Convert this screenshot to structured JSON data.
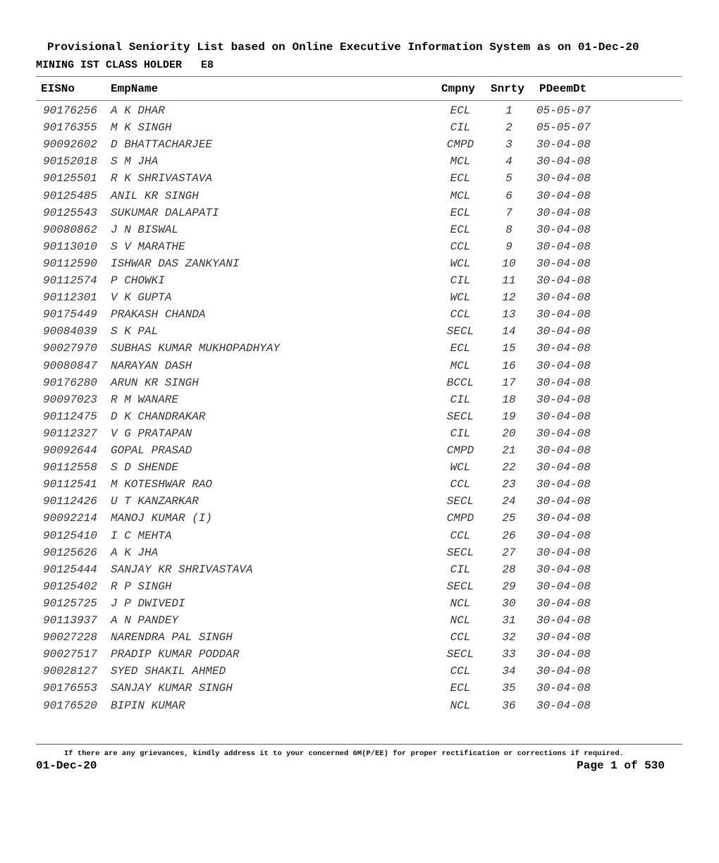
{
  "header": {
    "title": "Provisional Seniority List based on Online Executive Information System as on 01-Dec-20",
    "subtitle": "MINING IST CLASS HOLDER   E8"
  },
  "table": {
    "columns": [
      "EISNo",
      "EmpName",
      "Cmpny",
      "Snrty",
      "PDeemDt"
    ],
    "rows": [
      {
        "eis": "90176256",
        "name": "A K DHAR",
        "cmpny": "ECL",
        "snrty": "1",
        "pdeem": "05-05-07"
      },
      {
        "eis": "90176355",
        "name": "M K SINGH",
        "cmpny": "CIL",
        "snrty": "2",
        "pdeem": "05-05-07"
      },
      {
        "eis": "90092602",
        "name": "D BHATTACHARJEE",
        "cmpny": "CMPD",
        "snrty": "3",
        "pdeem": "30-04-08"
      },
      {
        "eis": "90152018",
        "name": "S M JHA",
        "cmpny": "MCL",
        "snrty": "4",
        "pdeem": "30-04-08"
      },
      {
        "eis": "90125501",
        "name": "R K SHRIVASTAVA",
        "cmpny": "ECL",
        "snrty": "5",
        "pdeem": "30-04-08"
      },
      {
        "eis": "90125485",
        "name": "ANIL KR SINGH",
        "cmpny": "MCL",
        "snrty": "6",
        "pdeem": "30-04-08"
      },
      {
        "eis": "90125543",
        "name": "SUKUMAR DALAPATI",
        "cmpny": "ECL",
        "snrty": "7",
        "pdeem": "30-04-08"
      },
      {
        "eis": "90080862",
        "name": "J N BISWAL",
        "cmpny": "ECL",
        "snrty": "8",
        "pdeem": "30-04-08"
      },
      {
        "eis": "90113010",
        "name": "S V MARATHE",
        "cmpny": "CCL",
        "snrty": "9",
        "pdeem": "30-04-08"
      },
      {
        "eis": "90112590",
        "name": "ISHWAR DAS ZANKYANI",
        "cmpny": "WCL",
        "snrty": "10",
        "pdeem": "30-04-08"
      },
      {
        "eis": "90112574",
        "name": "P CHOWKI",
        "cmpny": "CIL",
        "snrty": "11",
        "pdeem": "30-04-08"
      },
      {
        "eis": "90112301",
        "name": "V K GUPTA",
        "cmpny": "WCL",
        "snrty": "12",
        "pdeem": "30-04-08"
      },
      {
        "eis": "90175449",
        "name": "PRAKASH CHANDA",
        "cmpny": "CCL",
        "snrty": "13",
        "pdeem": "30-04-08"
      },
      {
        "eis": "90084039",
        "name": "S K PAL",
        "cmpny": "SECL",
        "snrty": "14",
        "pdeem": "30-04-08"
      },
      {
        "eis": "90027970",
        "name": "SUBHAS KUMAR MUKHOPADHYAY",
        "cmpny": "ECL",
        "snrty": "15",
        "pdeem": "30-04-08"
      },
      {
        "eis": "90080847",
        "name": "NARAYAN DASH",
        "cmpny": "MCL",
        "snrty": "16",
        "pdeem": "30-04-08"
      },
      {
        "eis": "90176280",
        "name": "ARUN KR SINGH",
        "cmpny": "BCCL",
        "snrty": "17",
        "pdeem": "30-04-08"
      },
      {
        "eis": "90097023",
        "name": "R M WANARE",
        "cmpny": "CIL",
        "snrty": "18",
        "pdeem": "30-04-08"
      },
      {
        "eis": "90112475",
        "name": "D K CHANDRAKAR",
        "cmpny": "SECL",
        "snrty": "19",
        "pdeem": "30-04-08"
      },
      {
        "eis": "90112327",
        "name": "V G PRATAPAN",
        "cmpny": "CIL",
        "snrty": "20",
        "pdeem": "30-04-08"
      },
      {
        "eis": "90092644",
        "name": "GOPAL PRASAD",
        "cmpny": "CMPD",
        "snrty": "21",
        "pdeem": "30-04-08"
      },
      {
        "eis": "90112558",
        "name": "S D SHENDE",
        "cmpny": "WCL",
        "snrty": "22",
        "pdeem": "30-04-08"
      },
      {
        "eis": "90112541",
        "name": "M KOTESHWAR RAO",
        "cmpny": "CCL",
        "snrty": "23",
        "pdeem": "30-04-08"
      },
      {
        "eis": "90112426",
        "name": "U T KANZARKAR",
        "cmpny": "SECL",
        "snrty": "24",
        "pdeem": "30-04-08"
      },
      {
        "eis": "90092214",
        "name": "MANOJ KUMAR (I)",
        "cmpny": "CMPD",
        "snrty": "25",
        "pdeem": "30-04-08"
      },
      {
        "eis": "90125410",
        "name": "I C MEHTA",
        "cmpny": "CCL",
        "snrty": "26",
        "pdeem": "30-04-08"
      },
      {
        "eis": "90125626",
        "name": "A K JHA",
        "cmpny": "SECL",
        "snrty": "27",
        "pdeem": "30-04-08"
      },
      {
        "eis": "90125444",
        "name": "SANJAY KR SHRIVASTAVA",
        "cmpny": "CIL",
        "snrty": "28",
        "pdeem": "30-04-08"
      },
      {
        "eis": "90125402",
        "name": "R P SINGH",
        "cmpny": "SECL",
        "snrty": "29",
        "pdeem": "30-04-08"
      },
      {
        "eis": "90125725",
        "name": "J P DWIVEDI",
        "cmpny": "NCL",
        "snrty": "30",
        "pdeem": "30-04-08"
      },
      {
        "eis": "90113937",
        "name": "A N PANDEY",
        "cmpny": "NCL",
        "snrty": "31",
        "pdeem": "30-04-08"
      },
      {
        "eis": "90027228",
        "name": "NARENDRA PAL SINGH",
        "cmpny": "CCL",
        "snrty": "32",
        "pdeem": "30-04-08"
      },
      {
        "eis": "90027517",
        "name": "PRADIP KUMAR PODDAR",
        "cmpny": "SECL",
        "snrty": "33",
        "pdeem": "30-04-08"
      },
      {
        "eis": "90028127",
        "name": "SYED SHAKIL AHMED",
        "cmpny": "CCL",
        "snrty": "34",
        "pdeem": "30-04-08"
      },
      {
        "eis": "90176553",
        "name": "SANJAY KUMAR SINGH",
        "cmpny": "ECL",
        "snrty": "35",
        "pdeem": "30-04-08"
      },
      {
        "eis": "90176520",
        "name": "BIPIN KUMAR",
        "cmpny": "NCL",
        "snrty": "36",
        "pdeem": "30-04-08"
      }
    ]
  },
  "footer": {
    "notice": "If there are any grievances, kindly address it to your concerned GM(P/EE) for proper rectification or corrections if required.",
    "date": "01-Dec-20",
    "page": "Page 1 of 530"
  }
}
